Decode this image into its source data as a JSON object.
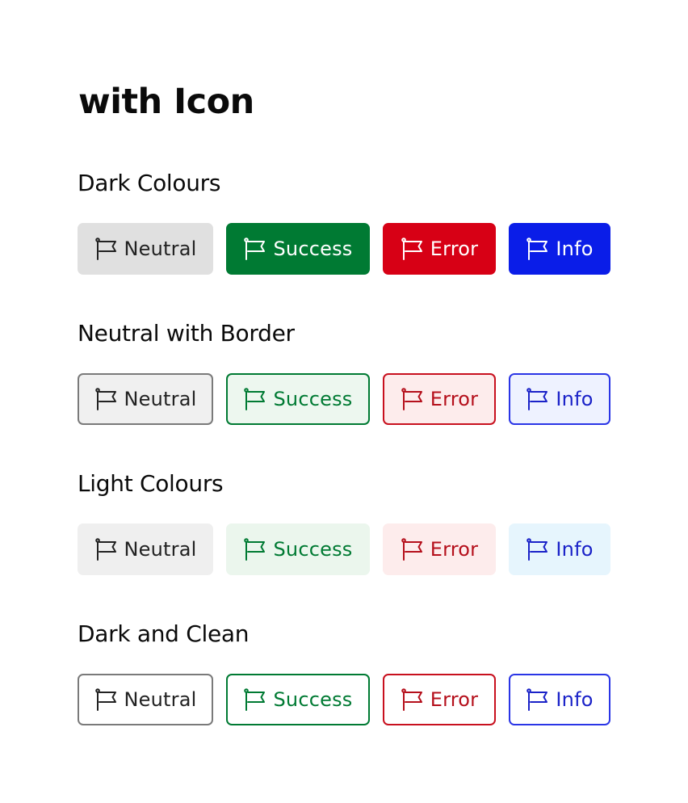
{
  "page": {
    "title": "with Icon"
  },
  "sections": [
    {
      "title": "Dark Colours",
      "tags": [
        {
          "label": "Neutral",
          "icon": "flag-icon"
        },
        {
          "label": "Success",
          "icon": "flag-icon"
        },
        {
          "label": "Error",
          "icon": "flag-icon"
        },
        {
          "label": "Info",
          "icon": "flag-icon"
        }
      ]
    },
    {
      "title": "Neutral with Border",
      "tags": [
        {
          "label": "Neutral",
          "icon": "flag-icon"
        },
        {
          "label": "Success",
          "icon": "flag-icon"
        },
        {
          "label": "Error",
          "icon": "flag-icon"
        },
        {
          "label": "Info",
          "icon": "flag-icon"
        }
      ]
    },
    {
      "title": "Light Colours",
      "tags": [
        {
          "label": "Neutral",
          "icon": "flag-icon"
        },
        {
          "label": "Success",
          "icon": "flag-icon"
        },
        {
          "label": "Error",
          "icon": "flag-icon"
        },
        {
          "label": "Info",
          "icon": "flag-icon"
        }
      ]
    },
    {
      "title": "Dark and Clean",
      "tags": [
        {
          "label": "Neutral",
          "icon": "flag-icon"
        },
        {
          "label": "Success",
          "icon": "flag-icon"
        },
        {
          "label": "Error",
          "icon": "flag-icon"
        },
        {
          "label": "Info",
          "icon": "flag-icon"
        }
      ]
    }
  ],
  "colors": {
    "neutral_dark": "#e0e0e0",
    "success_dark": "#007a33",
    "error_dark": "#d70015",
    "info_dark": "#0a1de8",
    "success_text": "#007a33",
    "error_text": "#b5101c",
    "info_text": "#1a22c8",
    "neutral_border": "#7a7a7a"
  }
}
